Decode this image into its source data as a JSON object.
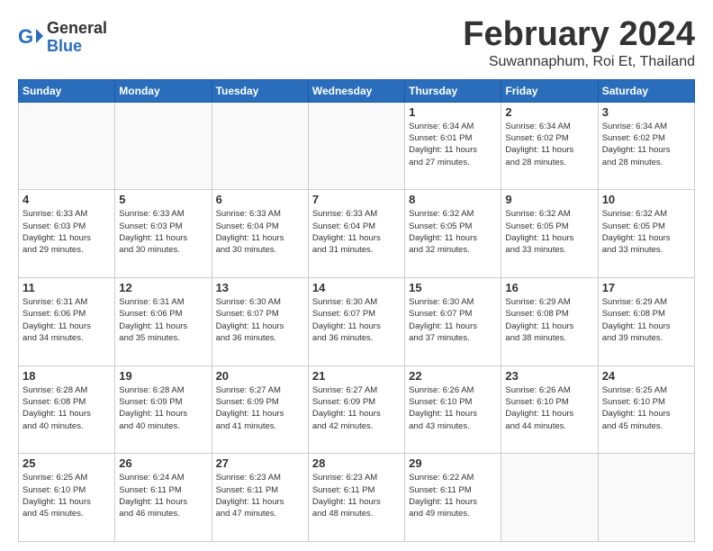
{
  "header": {
    "logo_general": "General",
    "logo_blue": "Blue",
    "month_title": "February 2024",
    "location": "Suwannaphum, Roi Et, Thailand"
  },
  "days_of_week": [
    "Sunday",
    "Monday",
    "Tuesday",
    "Wednesday",
    "Thursday",
    "Friday",
    "Saturday"
  ],
  "weeks": [
    [
      {
        "day": "",
        "detail": ""
      },
      {
        "day": "",
        "detail": ""
      },
      {
        "day": "",
        "detail": ""
      },
      {
        "day": "",
        "detail": ""
      },
      {
        "day": "1",
        "detail": "Sunrise: 6:34 AM\nSunset: 6:01 PM\nDaylight: 11 hours\nand 27 minutes."
      },
      {
        "day": "2",
        "detail": "Sunrise: 6:34 AM\nSunset: 6:02 PM\nDaylight: 11 hours\nand 28 minutes."
      },
      {
        "day": "3",
        "detail": "Sunrise: 6:34 AM\nSunset: 6:02 PM\nDaylight: 11 hours\nand 28 minutes."
      }
    ],
    [
      {
        "day": "4",
        "detail": "Sunrise: 6:33 AM\nSunset: 6:03 PM\nDaylight: 11 hours\nand 29 minutes."
      },
      {
        "day": "5",
        "detail": "Sunrise: 6:33 AM\nSunset: 6:03 PM\nDaylight: 11 hours\nand 30 minutes."
      },
      {
        "day": "6",
        "detail": "Sunrise: 6:33 AM\nSunset: 6:04 PM\nDaylight: 11 hours\nand 30 minutes."
      },
      {
        "day": "7",
        "detail": "Sunrise: 6:33 AM\nSunset: 6:04 PM\nDaylight: 11 hours\nand 31 minutes."
      },
      {
        "day": "8",
        "detail": "Sunrise: 6:32 AM\nSunset: 6:05 PM\nDaylight: 11 hours\nand 32 minutes."
      },
      {
        "day": "9",
        "detail": "Sunrise: 6:32 AM\nSunset: 6:05 PM\nDaylight: 11 hours\nand 33 minutes."
      },
      {
        "day": "10",
        "detail": "Sunrise: 6:32 AM\nSunset: 6:05 PM\nDaylight: 11 hours\nand 33 minutes."
      }
    ],
    [
      {
        "day": "11",
        "detail": "Sunrise: 6:31 AM\nSunset: 6:06 PM\nDaylight: 11 hours\nand 34 minutes."
      },
      {
        "day": "12",
        "detail": "Sunrise: 6:31 AM\nSunset: 6:06 PM\nDaylight: 11 hours\nand 35 minutes."
      },
      {
        "day": "13",
        "detail": "Sunrise: 6:30 AM\nSunset: 6:07 PM\nDaylight: 11 hours\nand 36 minutes."
      },
      {
        "day": "14",
        "detail": "Sunrise: 6:30 AM\nSunset: 6:07 PM\nDaylight: 11 hours\nand 36 minutes."
      },
      {
        "day": "15",
        "detail": "Sunrise: 6:30 AM\nSunset: 6:07 PM\nDaylight: 11 hours\nand 37 minutes."
      },
      {
        "day": "16",
        "detail": "Sunrise: 6:29 AM\nSunset: 6:08 PM\nDaylight: 11 hours\nand 38 minutes."
      },
      {
        "day": "17",
        "detail": "Sunrise: 6:29 AM\nSunset: 6:08 PM\nDaylight: 11 hours\nand 39 minutes."
      }
    ],
    [
      {
        "day": "18",
        "detail": "Sunrise: 6:28 AM\nSunset: 6:08 PM\nDaylight: 11 hours\nand 40 minutes."
      },
      {
        "day": "19",
        "detail": "Sunrise: 6:28 AM\nSunset: 6:09 PM\nDaylight: 11 hours\nand 40 minutes."
      },
      {
        "day": "20",
        "detail": "Sunrise: 6:27 AM\nSunset: 6:09 PM\nDaylight: 11 hours\nand 41 minutes."
      },
      {
        "day": "21",
        "detail": "Sunrise: 6:27 AM\nSunset: 6:09 PM\nDaylight: 11 hours\nand 42 minutes."
      },
      {
        "day": "22",
        "detail": "Sunrise: 6:26 AM\nSunset: 6:10 PM\nDaylight: 11 hours\nand 43 minutes."
      },
      {
        "day": "23",
        "detail": "Sunrise: 6:26 AM\nSunset: 6:10 PM\nDaylight: 11 hours\nand 44 minutes."
      },
      {
        "day": "24",
        "detail": "Sunrise: 6:25 AM\nSunset: 6:10 PM\nDaylight: 11 hours\nand 45 minutes."
      }
    ],
    [
      {
        "day": "25",
        "detail": "Sunrise: 6:25 AM\nSunset: 6:10 PM\nDaylight: 11 hours\nand 45 minutes."
      },
      {
        "day": "26",
        "detail": "Sunrise: 6:24 AM\nSunset: 6:11 PM\nDaylight: 11 hours\nand 46 minutes."
      },
      {
        "day": "27",
        "detail": "Sunrise: 6:23 AM\nSunset: 6:11 PM\nDaylight: 11 hours\nand 47 minutes."
      },
      {
        "day": "28",
        "detail": "Sunrise: 6:23 AM\nSunset: 6:11 PM\nDaylight: 11 hours\nand 48 minutes."
      },
      {
        "day": "29",
        "detail": "Sunrise: 6:22 AM\nSunset: 6:11 PM\nDaylight: 11 hours\nand 49 minutes."
      },
      {
        "day": "",
        "detail": ""
      },
      {
        "day": "",
        "detail": ""
      }
    ]
  ]
}
